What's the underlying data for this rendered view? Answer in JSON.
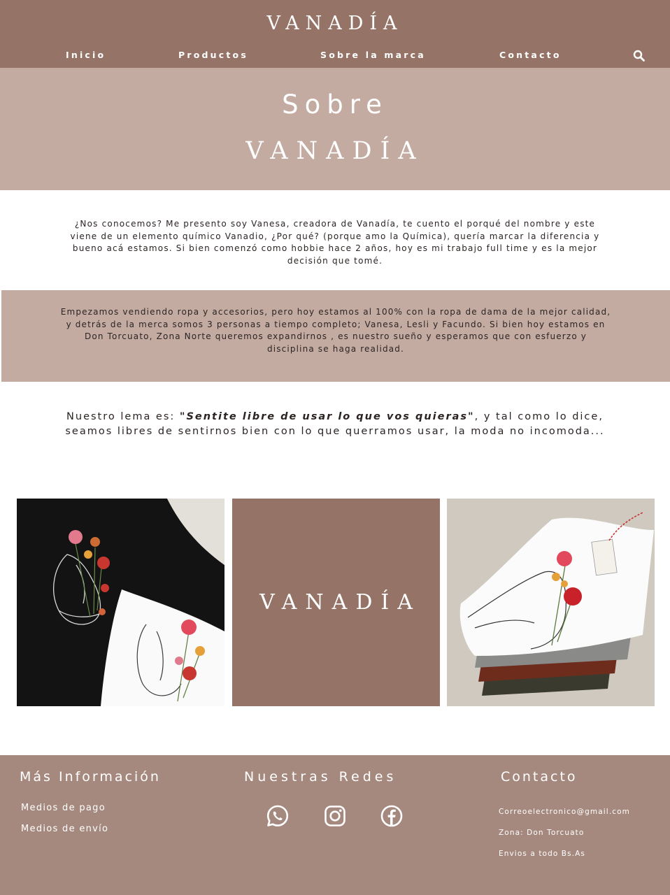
{
  "header": {
    "brand": "VANADÍA",
    "nav": [
      "Inicio",
      "Productos",
      "Sobre la marca",
      "Contacto"
    ],
    "search_icon": "search-icon"
  },
  "hero": {
    "line1": "Sobre",
    "line2": "VANADÍA"
  },
  "about": {
    "intro": "¿Nos conocemos? Me presento soy Vanesa, creadora de Vanadía, te cuento el porqué del nombre y este viene de un elemento químico Vanadio, ¿Por qué? (porque amo la Química), quería marcar la diferencia y bueno acá estamos. Si bien comenzó como hobbie hace 2 años, hoy es mi trabajo full time y es la mejor decisión que tomé.",
    "team": "Empezamos vendiendo ropa y accesorios, pero hoy estamos al 100% con la ropa de dama de la mejor calidad, y detrás de la merca somos 3 personas a tiempo completo; Vanesa, Lesli y Facundo. Si bien hoy estamos en Don Torcuato, Zona Norte queremos expandirnos , es nuestro sueño y esperamos que con esfuerzo y disciplina se haga realidad.",
    "motto_prefix": "Nuestro lema es:  ",
    "motto_quote": "\"Sentite libre de usar lo que vos quieras\"",
    "motto_suffix": ", y tal como lo dice, seamos libres de sentirnos bien con lo que querramos usar, la moda no incomoda..."
  },
  "gallery": {
    "brand": "VANADÍA"
  },
  "footer": {
    "info_title": "Más Información",
    "info_links": [
      "Medios de pago",
      "Medios de envío"
    ],
    "social_title": "Nuestras Redes",
    "social_icons": [
      "whatsapp-icon",
      "instagram-icon",
      "facebook-icon"
    ],
    "contact_title": "Contacto",
    "contact_email": "Correoelectronico@gmail.com",
    "contact_zone": "Zona: Don Torcuato",
    "contact_shipping": "Envios a todo Bs.As"
  },
  "colors": {
    "header": "#957467",
    "hero": "#c4aba2",
    "footer": "#a6897e",
    "text": "#2b2423"
  }
}
